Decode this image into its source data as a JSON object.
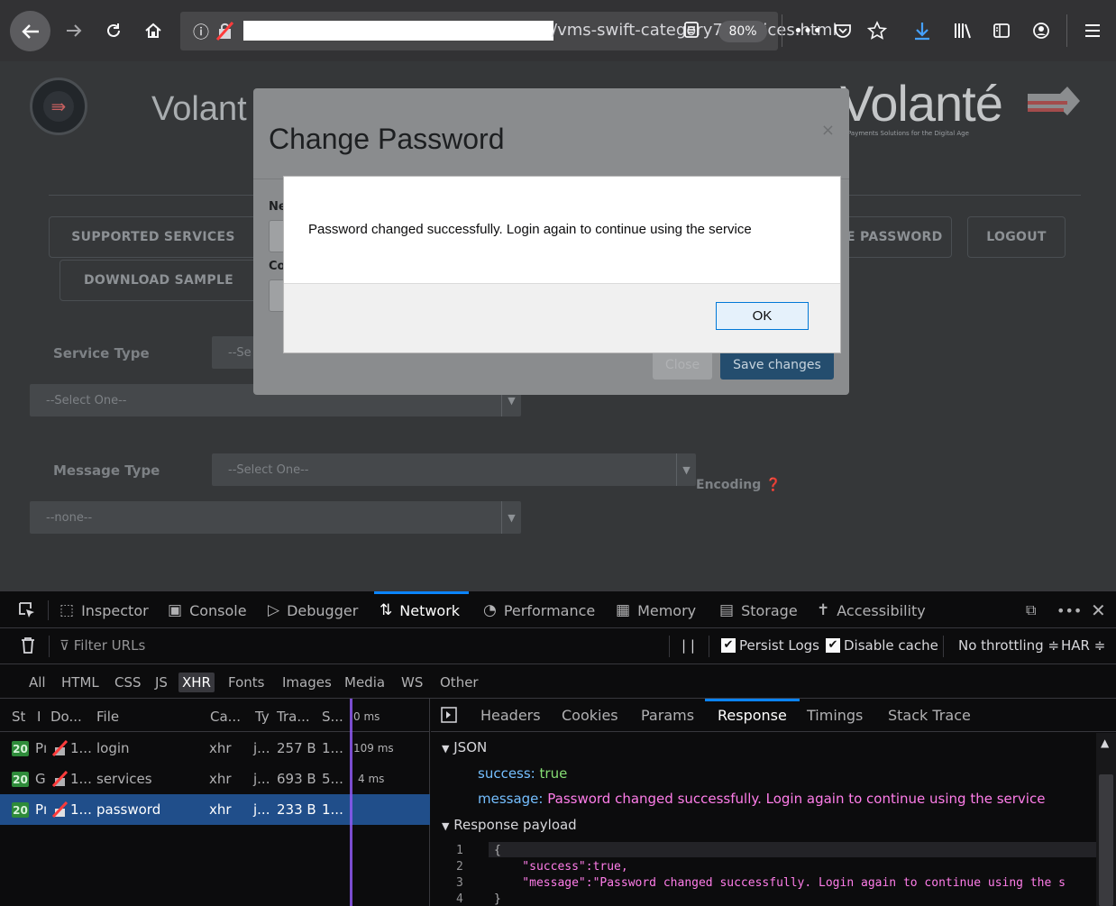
{
  "browser": {
    "url_path": "/vms-swift-category7/services.html",
    "zoom": "80%"
  },
  "page": {
    "brand_left": "Volant",
    "brand_right": "Volanté",
    "brand_tagline": "Payments Solutions for the Digital Age",
    "nav": {
      "supported_services": "SUPPORTED SERVICES",
      "download_sample": "DOWNLOAD SAMPLE",
      "change_password": "E PASSWORD",
      "logout": "LOGOUT"
    },
    "service_type_label": "Service Type",
    "service_type_value": "--Se",
    "select_one": "--Select One--",
    "message_type_label": "Message Type",
    "message_type_value": "--Select One--",
    "none_value": "--none--",
    "encoding_label": "Encoding"
  },
  "modal": {
    "title": "Change Password",
    "close_glyph": "×",
    "new_label": "Ne",
    "confirm_label": "Co",
    "close_button": "Close",
    "save_button": "Save changes"
  },
  "alert": {
    "message": "Password changed successfully. Login again to continue using the service",
    "ok": "OK"
  },
  "devtools": {
    "tabs": [
      "Inspector",
      "Console",
      "Debugger",
      "Network",
      "Performance",
      "Memory",
      "Storage",
      "Accessibility"
    ],
    "filter_placeholder": "Filter URLs",
    "persist_logs": "Persist Logs",
    "disable_cache": "Disable cache",
    "throttling": "No throttling ≑",
    "har": "HAR ≑",
    "pause": "| |",
    "types": [
      "All",
      "HTML",
      "CSS",
      "JS",
      "XHR",
      "Fonts",
      "Images",
      "Media",
      "WS",
      "Other"
    ],
    "columns": {
      "status": "St",
      "method": "I",
      "domain": "Do...",
      "file": "File",
      "cause": "Ca...",
      "type": "Ty",
      "transferred": "Tra...",
      "size": "S...",
      "waterfall": "0 ms"
    },
    "requests": [
      {
        "status": "20",
        "method": "Pı",
        "domain": "1...",
        "file": "login",
        "cause": "xhr",
        "type": "j...",
        "transferred": "257 B",
        "size": "1...",
        "time": "109 ms"
      },
      {
        "status": "20",
        "method": "G",
        "domain": "1...",
        "file": "services",
        "cause": "xhr",
        "type": "j...",
        "transferred": "693 B",
        "size": "5...",
        "time": "4 ms"
      },
      {
        "status": "20",
        "method": "Pı",
        "domain": "1...",
        "file": "password",
        "cause": "xhr",
        "type": "j...",
        "transferred": "233 B",
        "size": "1...",
        "time": ""
      }
    ],
    "detail_tabs": [
      "Headers",
      "Cookies",
      "Params",
      "Response",
      "Timings",
      "Stack Trace"
    ],
    "json_section": "JSON",
    "json": {
      "success_key": "success:",
      "success_val": "true",
      "message_key": "message:",
      "message_val": "Password changed successfully. Login again to continue using the service"
    },
    "payload_section": "Response payload",
    "payload_lines": [
      {
        "n": "1",
        "text": "{"
      },
      {
        "n": "2",
        "text": "    \"success\":true,"
      },
      {
        "n": "3",
        "text": "    \"message\":\"Password changed successfully. Login again to continue using the s"
      },
      {
        "n": "4",
        "text": "}"
      }
    ]
  }
}
